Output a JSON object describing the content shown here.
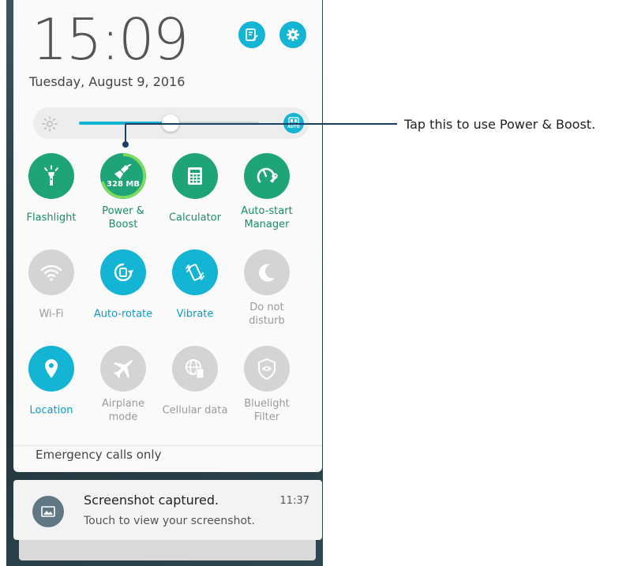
{
  "header": {
    "time": "15:09",
    "date": "Tuesday, August 9, 2016",
    "edit_icon": "edit-icon",
    "settings_icon": "gear-icon"
  },
  "brightness": {
    "level": 0.51,
    "auto_label": "AUTO"
  },
  "tiles": [
    {
      "label_1": "Flashlight",
      "label_2": "",
      "state": "active",
      "icon": "flashlight-icon"
    },
    {
      "label_1": "Power &",
      "label_2": "Boost",
      "state": "active",
      "icon": "broom-icon",
      "badge": "328 MB"
    },
    {
      "label_1": "Calculator",
      "label_2": "",
      "state": "active",
      "icon": "calculator-icon"
    },
    {
      "label_1": "Auto-start",
      "label_2": "Manager",
      "state": "active",
      "icon": "gauge-wrench-icon"
    },
    {
      "label_1": "Wi-Fi",
      "label_2": "",
      "state": "off",
      "icon": "wifi-icon"
    },
    {
      "label_1": "Auto-rotate",
      "label_2": "",
      "state": "on",
      "icon": "rotate-icon"
    },
    {
      "label_1": "Vibrate",
      "label_2": "",
      "state": "on",
      "icon": "vibrate-icon"
    },
    {
      "label_1": "Do not",
      "label_2": "disturb",
      "state": "off",
      "icon": "moon-icon"
    },
    {
      "label_1": "Location",
      "label_2": "",
      "state": "on",
      "icon": "location-pin-icon"
    },
    {
      "label_1": "Airplane",
      "label_2": "mode",
      "state": "off",
      "icon": "airplane-icon"
    },
    {
      "label_1": "Cellular data",
      "label_2": "",
      "state": "off",
      "icon": "globe-phone-icon"
    },
    {
      "label_1": "Bluelight",
      "label_2": "Filter",
      "state": "off",
      "icon": "eye-shield-icon"
    }
  ],
  "status": {
    "emergency": "Emergency calls only"
  },
  "notification": {
    "title": "Screenshot captured.",
    "time": "11:37",
    "body": "Touch to view your screenshot.",
    "icon": "image-icon"
  },
  "callout": {
    "text": "Tap this to use Power & Boost."
  },
  "colors": {
    "accent": "#13b4d4",
    "green": "#1fa47a",
    "off": "#d4d4d4",
    "callout": "#1a3f66"
  }
}
